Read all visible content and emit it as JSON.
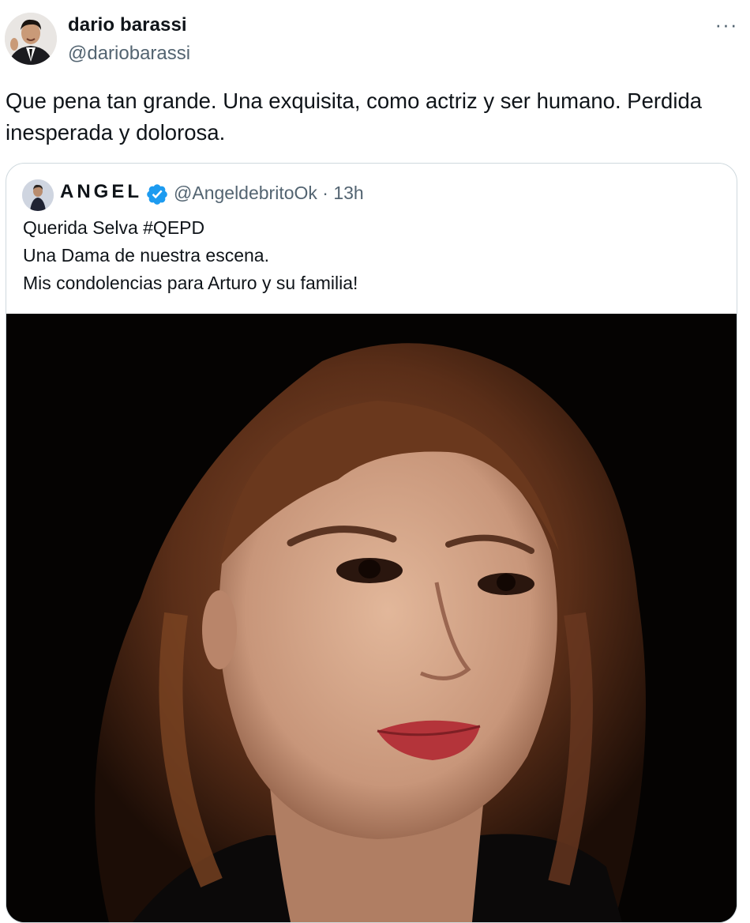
{
  "author": {
    "display_name": "dario barassi",
    "handle": "@dariobarassi",
    "avatar_icon": "avatar-photo-icon"
  },
  "more_label": "···",
  "tweet": {
    "text_line1": "Que pena tan grande. Una exquisita, como actriz y ser humano. Perdida",
    "text_line2": "inesperada y dolorosa."
  },
  "quoted": {
    "display_name": "ANGEL",
    "verified_icon": "verified-badge-icon",
    "handle_time": "@AngeldebritoOk · 13h",
    "lines": [
      "Querida Selva #QEPD",
      "Una Dama de nuestra escena.",
      "Mis condolencias para Arturo y su familia!"
    ]
  },
  "colors": {
    "text": "#0f1419",
    "secondary": "#536471",
    "border": "#cfd9de",
    "verified": "#1d9bf0"
  }
}
